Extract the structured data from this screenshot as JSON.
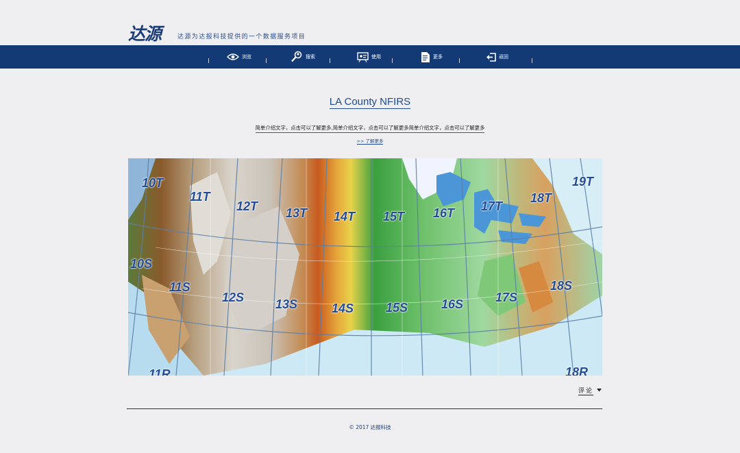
{
  "header": {
    "logo_text": "达源",
    "tagline": "达源为达报科技提供的一个数据服务项目"
  },
  "nav": {
    "items": [
      {
        "label": "浏览",
        "icon": "eye-icon"
      },
      {
        "label": "搜索",
        "icon": "search-user-icon"
      },
      {
        "label": "使用",
        "icon": "presentation-icon"
      },
      {
        "label": "更多",
        "icon": "document-icon"
      },
      {
        "label": "返回",
        "icon": "exit-icon"
      }
    ]
  },
  "main": {
    "title": "LA County NFIRS",
    "intro": "简单介绍文字，点击可以了解更多,简单介绍文字，点击可以了解更多简单介绍文字，点击可以了解更多",
    "more_link": ">>  了解更多"
  },
  "map": {
    "zones": [
      "10T",
      "11T",
      "12T",
      "13T",
      "14T",
      "15T",
      "16T",
      "17T",
      "18T",
      "19T",
      "10S",
      "11S",
      "12S",
      "13S",
      "14S",
      "15S",
      "16S",
      "17S",
      "18S",
      "11R",
      "18R"
    ]
  },
  "comments": {
    "label": "评论"
  },
  "footer": {
    "copyright": "© 2017 达报科技"
  }
}
